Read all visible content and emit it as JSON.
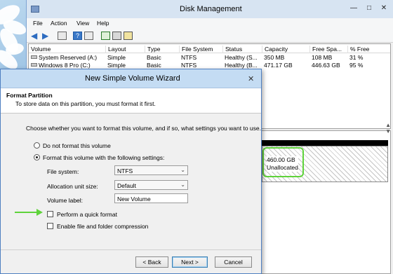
{
  "dm": {
    "title": "Disk Management",
    "menu": [
      "File",
      "Action",
      "View",
      "Help"
    ],
    "columns": [
      "Volume",
      "Layout",
      "Type",
      "File System",
      "Status",
      "Capacity",
      "Free Spa...",
      "% Free"
    ],
    "rows": [
      {
        "volume": "System Reserved (A:)",
        "layout": "Simple",
        "type": "Basic",
        "fs": "NTFS",
        "status": "Healthy (S...",
        "capacity": "350 MB",
        "free": "108 MB",
        "pct": "31 %"
      },
      {
        "volume": "Windows 8 Pro (C:)",
        "layout": "Simple",
        "type": "Basic",
        "fs": "NTFS",
        "status": "Healthy (B...",
        "capacity": "471.17 GB",
        "free": "446.63 GB",
        "pct": "95 %"
      }
    ],
    "unallocated": {
      "size": "460.00 GB",
      "label": "Unallocated"
    }
  },
  "wizard": {
    "title": "New Simple Volume Wizard",
    "header_title": "Format Partition",
    "header_desc": "To store data on this partition, you must format it first.",
    "prompt": "Choose whether you want to format this volume, and if so, what settings you want to use.",
    "radio_no_format": "Do not format this volume",
    "radio_format": "Format this volume with the following settings:",
    "fs_label": "File system:",
    "fs_value": "NTFS",
    "alloc_label": "Allocation unit size:",
    "alloc_value": "Default",
    "vol_label": "Volume label:",
    "vol_value": "New Volume",
    "quick_format": "Perform a quick format",
    "compression": "Enable file and folder compression",
    "back": "< Back",
    "next": "Next >",
    "cancel": "Cancel"
  },
  "colors": {
    "highlight": "#5fd33b",
    "titlebar": "#c4dcf3"
  }
}
